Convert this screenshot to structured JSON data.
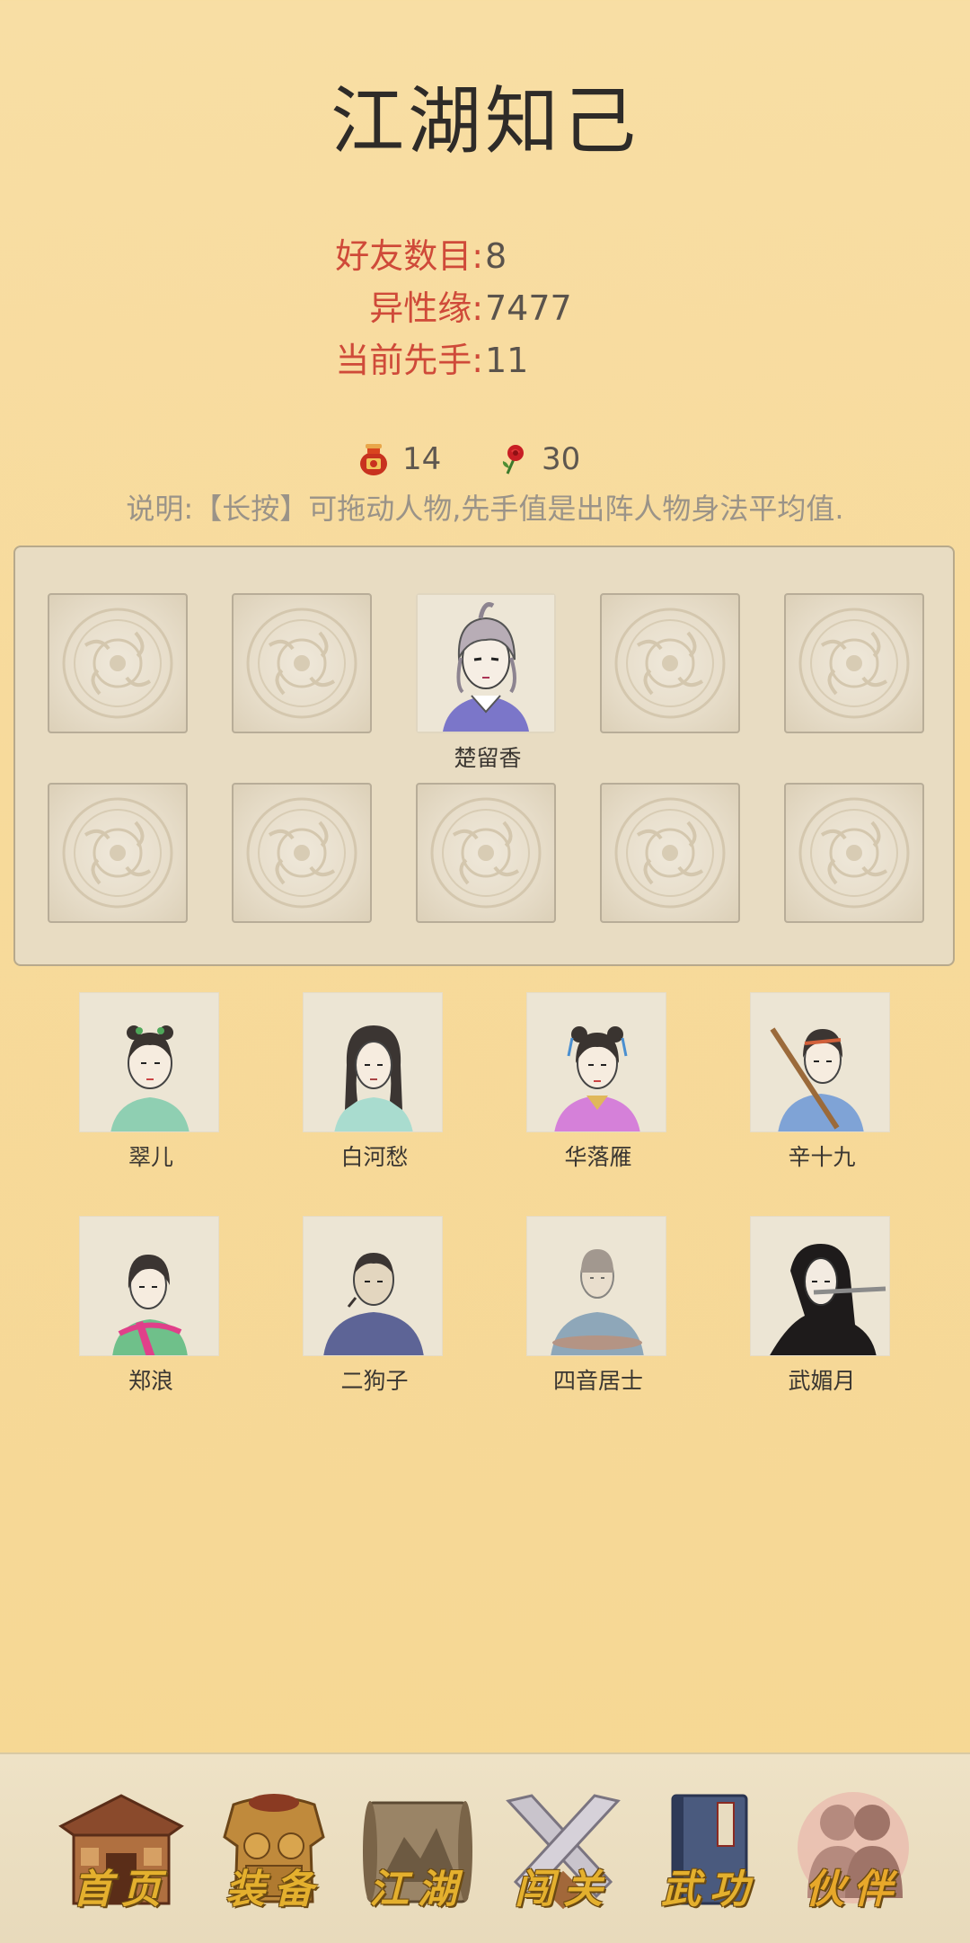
{
  "page": {
    "title": "江湖知己"
  },
  "stats": [
    {
      "label": "好友数目:",
      "value": "8"
    },
    {
      "label": "异性缘:",
      "value": "7477"
    },
    {
      "label": "当前先手:",
      "value": "11"
    }
  ],
  "resources": {
    "wine": {
      "icon": "wine-jar-icon",
      "value": "14"
    },
    "rose": {
      "icon": "rose-icon",
      "value": "30"
    }
  },
  "hint": "说明:【长按】可拖动人物,先手值是出阵人物身法平均值.",
  "lineup": {
    "slots": [
      {
        "name": ""
      },
      {
        "name": ""
      },
      {
        "name": "楚留香",
        "filled": true
      },
      {
        "name": ""
      },
      {
        "name": ""
      },
      {
        "name": ""
      },
      {
        "name": ""
      },
      {
        "name": ""
      },
      {
        "name": ""
      },
      {
        "name": ""
      }
    ]
  },
  "friends": [
    {
      "name": "翠儿"
    },
    {
      "name": "白河愁"
    },
    {
      "name": "华落雁"
    },
    {
      "name": "辛十九"
    },
    {
      "name": "郑浪"
    },
    {
      "name": "二狗子"
    },
    {
      "name": "四音居士"
    },
    {
      "name": "武媚月"
    }
  ],
  "nav": [
    {
      "label": "首页",
      "icon": "house-icon"
    },
    {
      "label": "装备",
      "icon": "armor-icon"
    },
    {
      "label": "江湖",
      "icon": "scroll-map-icon"
    },
    {
      "label": "闯关",
      "icon": "crossed-swords-icon"
    },
    {
      "label": "武功",
      "icon": "martial-book-icon"
    },
    {
      "label": "伙伴",
      "icon": "companions-icon",
      "active": true
    }
  ],
  "colors": {
    "background": "#f8dea4",
    "label_red": "#cf4a39",
    "value_gray": "#5a534c",
    "nav_gold": "#e4b02e"
  }
}
